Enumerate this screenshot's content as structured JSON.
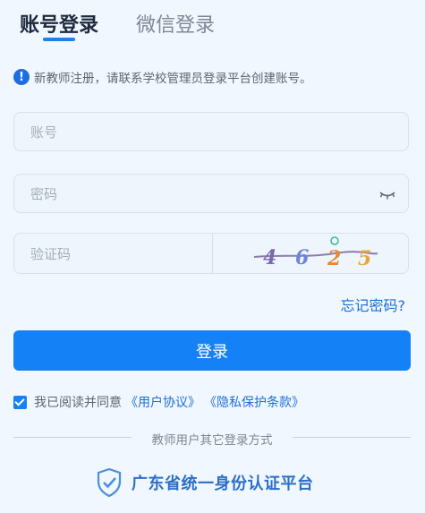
{
  "tabs": {
    "account_login": "账号登录",
    "wechat_login": "微信登录"
  },
  "notice": {
    "icon": "info-icon",
    "text": "新教师注册，请联系学校管理员登录平台创建账号。"
  },
  "form": {
    "account_placeholder": "账号",
    "password_placeholder": "密码",
    "captcha_placeholder": "验证码",
    "captcha_chars": [
      "4",
      "6",
      "2",
      "5"
    ],
    "forgot_label": "忘记密码?",
    "login_label": "登录"
  },
  "agreement": {
    "checked": true,
    "prefix": "我已阅读并同意",
    "user_agreement": "《用户协议》",
    "privacy_policy": "《隐私保护条款》"
  },
  "other_login": {
    "divider_text": "教师用户其它登录方式",
    "platform_label": "广东省统一身份认证平台",
    "platform_icon": "shield-check-icon"
  },
  "colors": {
    "primary": "#1581f6",
    "link": "#1d6fd8",
    "background": "#f1f7fe"
  }
}
